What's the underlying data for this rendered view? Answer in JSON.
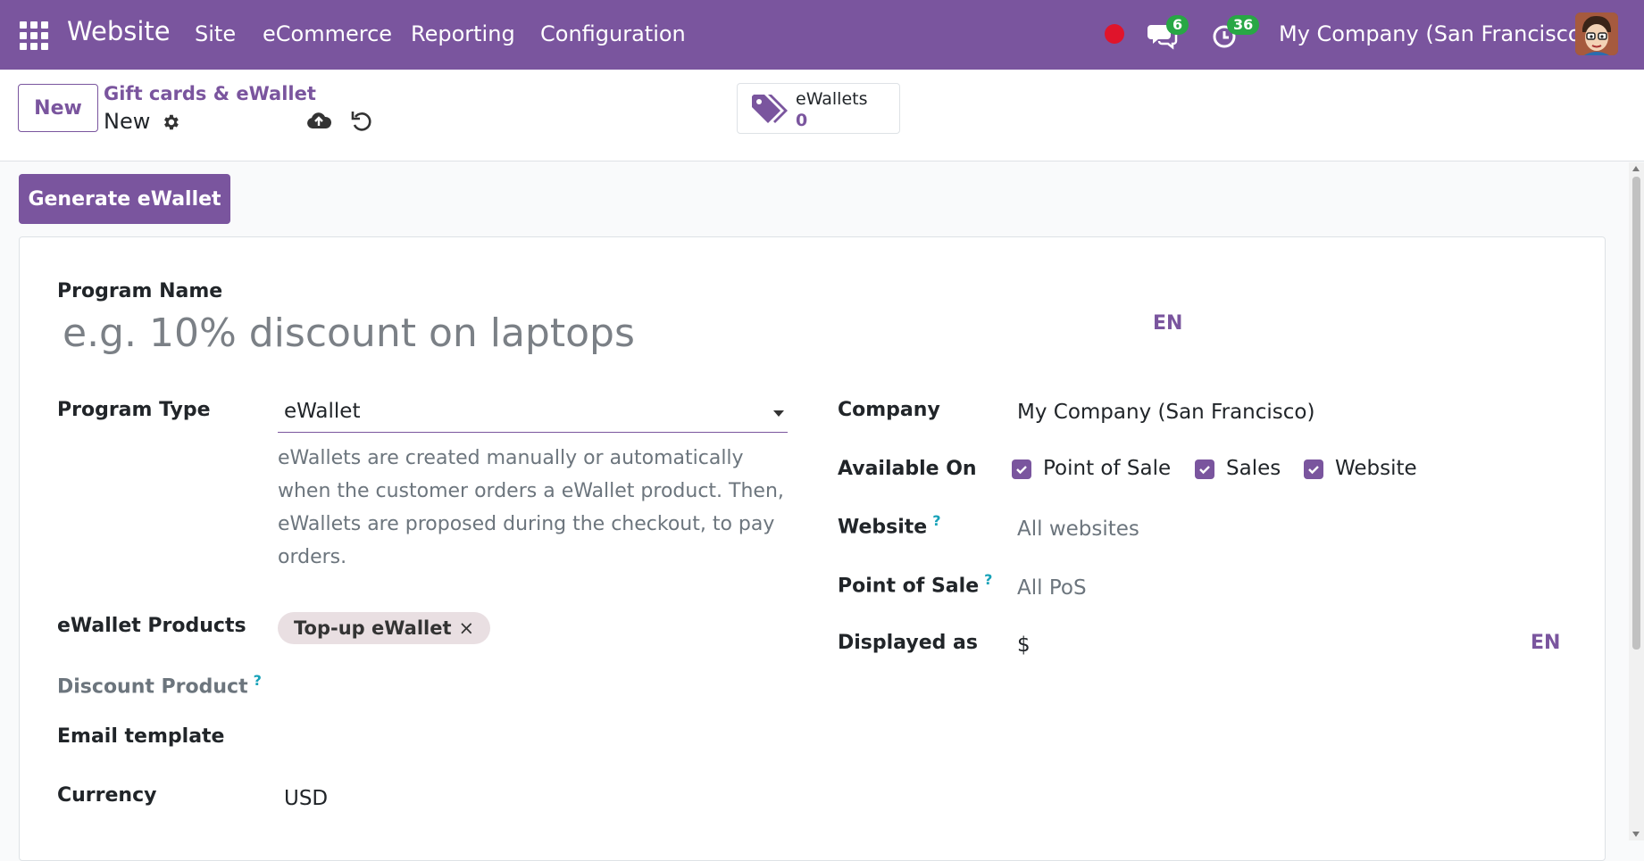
{
  "navbar": {
    "app_name": "Website",
    "menu": [
      "Site",
      "eCommerce",
      "Reporting",
      "Configuration"
    ],
    "messages_count": "6",
    "activities_count": "36",
    "company": "My Company (San Francisco)"
  },
  "control_panel": {
    "new_label": "New",
    "breadcrumb": "Gift cards & eWallet",
    "record_name": "New",
    "smart_button": {
      "label": "eWallets",
      "value": "0"
    }
  },
  "actions": {
    "generate_label": "Generate eWallet"
  },
  "form": {
    "program_name_label": "Program Name",
    "program_name_placeholder": "e.g. 10% discount on laptops",
    "lang_tag": "EN",
    "program_type_label": "Program Type",
    "program_type_value": "eWallet",
    "program_type_help": "eWallets are created manually or automatically when the customer orders a eWallet product. Then, eWallets are proposed during the checkout, to pay orders.",
    "ewallet_products_label": "eWallet Products",
    "ewallet_product_tag": "Top-up eWallet",
    "tag_remove": "×",
    "discount_product_label": "Discount Product",
    "help_mark": "?",
    "email_template_label": "Email template",
    "currency_label": "Currency",
    "currency_value": "USD",
    "company_label": "Company",
    "company_value": "My Company (San Francisco)",
    "available_on_label": "Available On",
    "available_on": [
      "Point of Sale",
      "Sales",
      "Website"
    ],
    "website_label": "Website",
    "website_value": "All websites",
    "pos_label": "Point of Sale",
    "pos_value": "All PoS",
    "displayed_as_label": "Displayed as",
    "displayed_as_value": "$",
    "displayed_as_lang": "EN"
  },
  "colors": {
    "brand": "#7a559e",
    "badge": "#28a745",
    "record": "#e0142b"
  }
}
